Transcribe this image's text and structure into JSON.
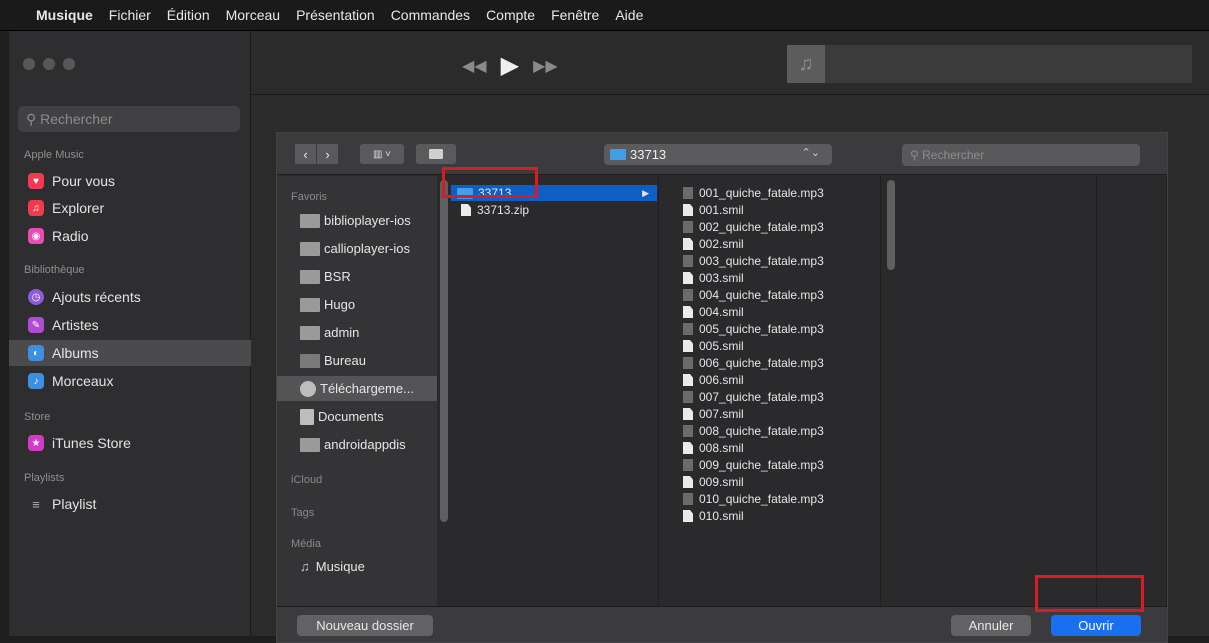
{
  "menubar": {
    "items": [
      "Musique",
      "Fichier",
      "Édition",
      "Morceau",
      "Présentation",
      "Commandes",
      "Compte",
      "Fenêtre",
      "Aide"
    ]
  },
  "sidebar": {
    "search_placeholder": "Rechercher",
    "sections": {
      "apple_music": "Apple Music",
      "library": "Bibliothèque",
      "store": "Store",
      "playlists": "Playlists"
    },
    "apple_music_items": [
      "Pour vous",
      "Explorer",
      "Radio"
    ],
    "library_items": [
      "Ajouts récents",
      "Artistes",
      "Albums",
      "Morceaux"
    ],
    "store_items": [
      "iTunes Store"
    ],
    "playlist_items": [
      "Playlist"
    ],
    "selected": "Albums"
  },
  "dialog": {
    "path": "33713",
    "search_placeholder": "Rechercher",
    "sidebar": {
      "favorites_label": "Favoris",
      "favorites": [
        "biblioplayer-ios",
        "callioplayer-ios",
        "BSR",
        "Hugo",
        "admin",
        "Bureau",
        "Téléchargeme...",
        "Documents",
        "androidappdis"
      ],
      "icloud_label": "iCloud",
      "tags_label": "Tags",
      "media_label": "Média",
      "media": [
        "Musique"
      ]
    },
    "column1": [
      "33713",
      "33713.zip"
    ],
    "column2": [
      "001_quiche_fatale.mp3",
      "001.smil",
      "002_quiche_fatale.mp3",
      "002.smil",
      "003_quiche_fatale.mp3",
      "003.smil",
      "004_quiche_fatale.mp3",
      "004.smil",
      "005_quiche_fatale.mp3",
      "005.smil",
      "006_quiche_fatale.mp3",
      "006.smil",
      "007_quiche_fatale.mp3",
      "007.smil",
      "008_quiche_fatale.mp3",
      "008.smil",
      "009_quiche_fatale.mp3",
      "009.smil",
      "010_quiche_fatale.mp3",
      "010.smil"
    ],
    "buttons": {
      "new_folder": "Nouveau dossier",
      "cancel": "Annuler",
      "open": "Ouvrir"
    }
  },
  "colors": {
    "accent": "#1a6ef0",
    "selection": "#0e5fc5",
    "highlight": "#d91c24"
  }
}
